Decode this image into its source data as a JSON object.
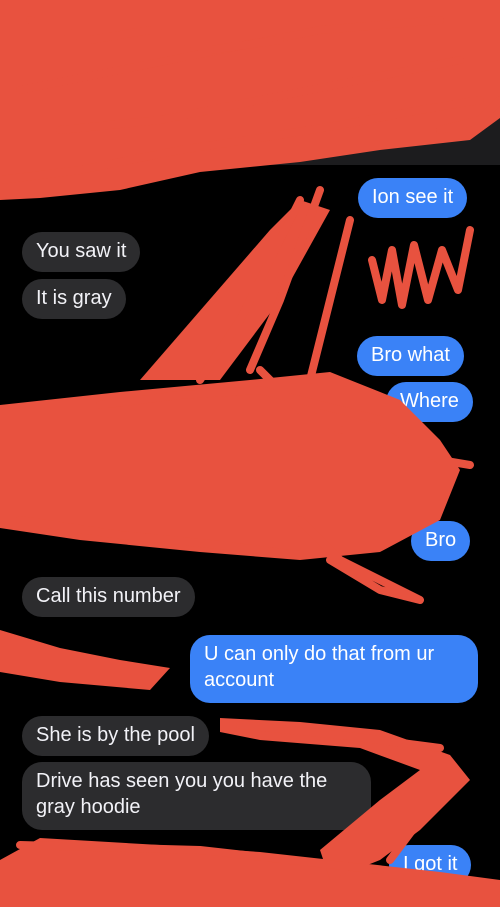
{
  "header": {
    "back_icon": "chevron-left-icon",
    "video_icon": "video-camera-icon",
    "accent_color": "#3a82f7"
  },
  "messages": [
    {
      "side": "sent",
      "text": "Ion see it"
    },
    {
      "side": "received",
      "text": "You saw it"
    },
    {
      "side": "received",
      "text": "It is gray"
    },
    {
      "side": "sent",
      "text": "Bro what"
    },
    {
      "side": "sent",
      "text": "Where"
    },
    {
      "side": "sent",
      "text": "Bro"
    },
    {
      "side": "received",
      "text": "Call this number"
    },
    {
      "side": "sent",
      "text": "U can only do that from ur account"
    },
    {
      "side": "received",
      "text": "She is by the pool"
    },
    {
      "side": "received",
      "text": "Drive has seen you you have the gray hoodie"
    },
    {
      "side": "sent",
      "text": "I got it"
    }
  ],
  "colors": {
    "background": "#000000",
    "received_bubble": "#2c2c2e",
    "sent_bubble": "#3a82f7",
    "redaction": "#e8523f"
  }
}
